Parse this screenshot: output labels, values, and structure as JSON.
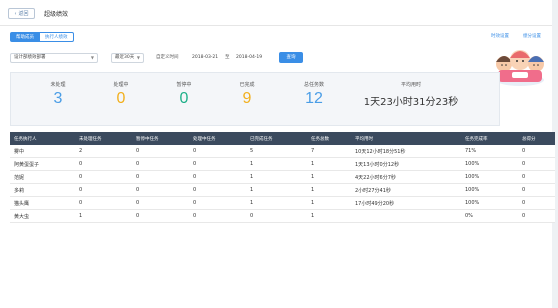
{
  "header": {
    "back_label": "返回",
    "page_title": "超级绩效"
  },
  "tabs": [
    {
      "label": "帮助成员",
      "active": true
    },
    {
      "label": "执行人绩效",
      "active": false
    }
  ],
  "top_links": [
    "时效设置",
    "绩分设置"
  ],
  "filters": {
    "project_select": "设计部绩效部署",
    "range_select": "最近30天",
    "custom_time_label": "自定义时间",
    "start_date": "2018-03-21",
    "separator": "至",
    "end_date": "2018-04-19",
    "query_button": "查询"
  },
  "stats": [
    {
      "label": "未处理",
      "value": "3",
      "color": "#4a9de6"
    },
    {
      "label": "处理中",
      "value": "0",
      "color": "#f2b01e"
    },
    {
      "label": "暂停中",
      "value": "0",
      "color": "#1fb08a"
    },
    {
      "label": "已完成",
      "value": "9",
      "color": "#f2b01e"
    },
    {
      "label": "总任务数",
      "value": "12",
      "color": "#4a9de6"
    },
    {
      "label": "平均用时",
      "value": "1天23小时31分23秒",
      "color": "#333333"
    }
  ],
  "table": {
    "headers": [
      "任务执行人",
      "未处理任务",
      "暂停中任务",
      "处理中任务",
      "已完成任务",
      "任务总数",
      "平均用时",
      "任务完成率",
      "总得分"
    ],
    "rows": [
      [
        "雾中",
        "2",
        "0",
        "0",
        "5",
        "7",
        "10天12小时18分51秒",
        "71%",
        "0"
      ],
      [
        "阿黄蛋蛋子",
        "0",
        "0",
        "0",
        "1",
        "1",
        "1天13小时0分12秒",
        "100%",
        "0"
      ],
      [
        "范妮",
        "0",
        "0",
        "0",
        "1",
        "1",
        "4天22小时6分7秒",
        "100%",
        "0"
      ],
      [
        "多莉",
        "0",
        "0",
        "0",
        "1",
        "1",
        "2小时27分41秒",
        "100%",
        "0"
      ],
      [
        "猫头鹰",
        "0",
        "0",
        "0",
        "1",
        "1",
        "17小时49分20秒",
        "100%",
        "0"
      ],
      [
        "黄大虫",
        "1",
        "0",
        "0",
        "0",
        "1",
        "",
        "0%",
        "0"
      ]
    ]
  }
}
